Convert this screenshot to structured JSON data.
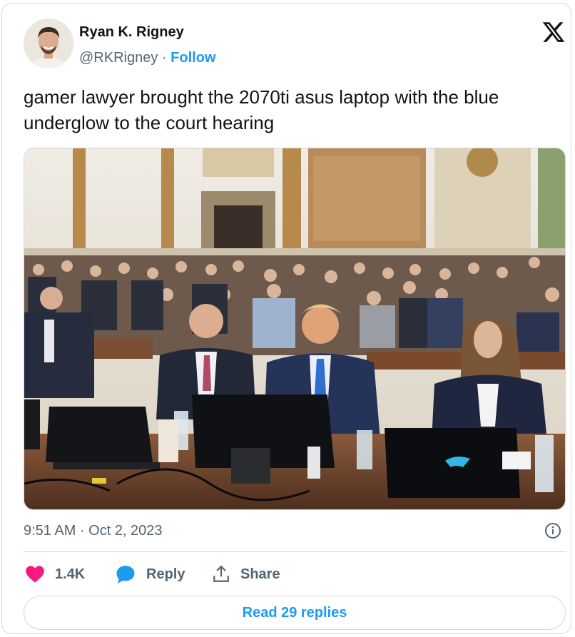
{
  "author": {
    "name": "Ryan K. Rigney",
    "handle": "@RKRigney",
    "separator": "·",
    "follow_label": "Follow"
  },
  "tweet": {
    "text": "gamer lawyer brought the 2070ti asus laptop with the blue underglow to the court hearing",
    "timestamp": "9:51 AM · Oct 2, 2023"
  },
  "actions": {
    "likes_count": "1.4K",
    "reply_label": "Reply",
    "share_label": "Share",
    "read_replies_label": "Read 29 replies"
  },
  "colors": {
    "accent": "#1d9bf0",
    "heart": "#f91880",
    "text_primary": "#0f1419",
    "text_secondary": "#536471",
    "border": "#cfd9de"
  },
  "icons": [
    "x-logo-icon",
    "info-icon",
    "heart-icon",
    "reply-bubble-icon",
    "share-icon"
  ]
}
